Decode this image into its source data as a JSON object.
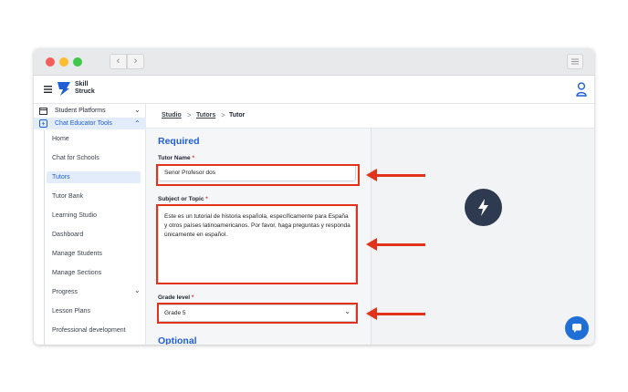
{
  "brand": {
    "line1": "Skill",
    "line2": "Struck"
  },
  "sidebar": {
    "groups": [
      {
        "label": "Student Platforms"
      },
      {
        "label": "Chat Educator Tools"
      }
    ],
    "items": [
      {
        "label": "Home"
      },
      {
        "label": "Chat for Schools"
      },
      {
        "label": "Tutors"
      },
      {
        "label": "Tutor Bank"
      },
      {
        "label": "Learning Studio"
      },
      {
        "label": "Dashboard"
      },
      {
        "label": "Manage Students"
      },
      {
        "label": "Manage Sections"
      },
      {
        "label": "Progress"
      },
      {
        "label": "Lesson Plans"
      },
      {
        "label": "Professional development"
      }
    ],
    "active_item": "Tutors"
  },
  "breadcrumb": {
    "first": "Studio",
    "second": "Tutors",
    "current": "Tutor",
    "separator": ">"
  },
  "form": {
    "required_heading": "Required",
    "tutor_name_label": "Tutor Name",
    "tutor_name_value": "Senor Profesor dos",
    "subject_label": "Subject or Topic",
    "subject_value": "Este es un tutorial de historia española, específicamente para España y otros países latinoamericanos. Por favor, haga preguntas y responda únicamente en español.",
    "grade_label": "Grade level",
    "grade_value": "Grade 5",
    "optional_heading": "Optional",
    "required_marker": "*"
  },
  "icons": {
    "menu": "hamburger-icon",
    "logo": "skillstruck-logo-icon",
    "user": "user-icon",
    "preview": "lightning-bolt-icon",
    "chat": "chat-bubble-icon",
    "back": "chevron-left-icon",
    "forward": "chevron-right-icon"
  },
  "colors": {
    "accent": "#1f5fd6",
    "highlight": "#e2321b",
    "active_bg": "#e3ecfb",
    "preview_circle": "#2e3a4f"
  }
}
